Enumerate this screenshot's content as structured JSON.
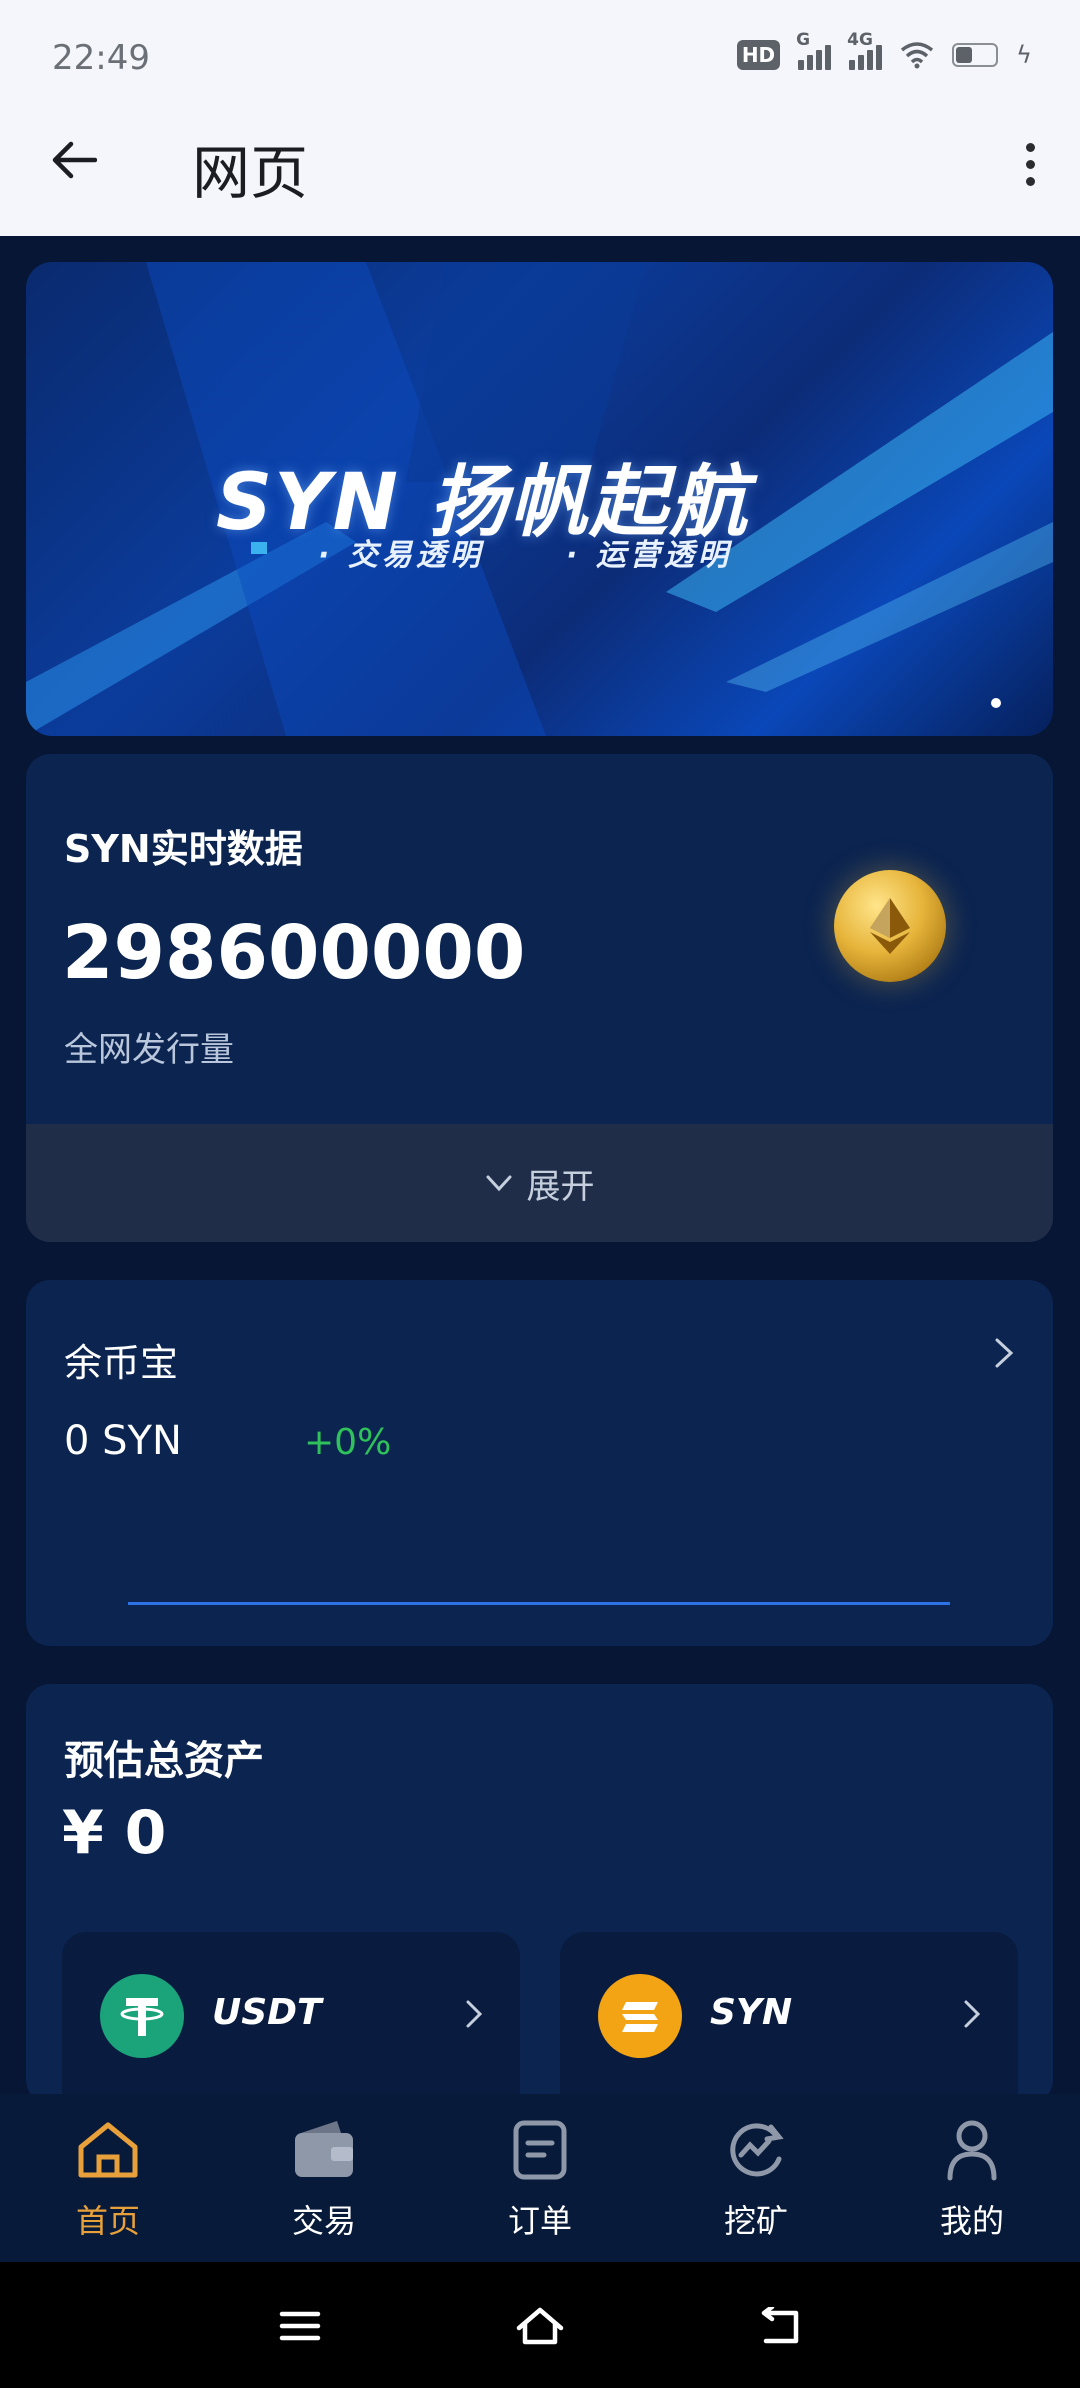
{
  "status_bar": {
    "time": "22:49",
    "hd_label": "HD",
    "signal1_label": "G",
    "signal2_label": "4G"
  },
  "header": {
    "title": "网页"
  },
  "banner": {
    "title": "SYN 扬帆起航",
    "subtitle_1": "· 交易透明",
    "subtitle_2": "· 运营透明"
  },
  "syn_card": {
    "label": "SYN实时数据",
    "value": "298600000",
    "caption": "全网发行量",
    "expand_label": "展开"
  },
  "yubibao": {
    "title": "余币宝",
    "value": "0 SYN",
    "change": "+0%"
  },
  "assets": {
    "title": "预估总资产",
    "value": "¥ 0",
    "coins": [
      {
        "name": "USDT",
        "icon": "tether-icon",
        "color": "#1ba37a"
      },
      {
        "name": "SYN",
        "icon": "syn-coin-icon",
        "color": "#f3a414"
      }
    ]
  },
  "bottom_nav": {
    "active_color": "#e8a13a",
    "items": [
      {
        "label": "首页",
        "icon": "home-icon",
        "active": true
      },
      {
        "label": "交易",
        "icon": "wallet-icon",
        "active": false
      },
      {
        "label": "订单",
        "icon": "order-icon",
        "active": false
      },
      {
        "label": "挖矿",
        "icon": "mining-icon",
        "active": false
      },
      {
        "label": "我的",
        "icon": "profile-icon",
        "active": false
      }
    ]
  }
}
